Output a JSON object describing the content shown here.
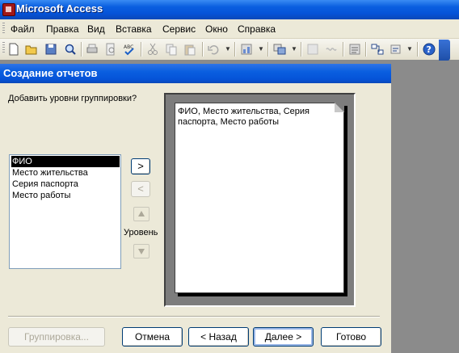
{
  "app": {
    "title": "Microsoft Access"
  },
  "menu": [
    {
      "label": "Файл"
    },
    {
      "label": "Правка"
    },
    {
      "label": "Вид"
    },
    {
      "label": "Вставка"
    },
    {
      "label": "Сервис"
    },
    {
      "label": "Окно"
    },
    {
      "label": "Справка"
    }
  ],
  "toolbar": {
    "icons": [
      "new-icon",
      "open-icon",
      "save-icon",
      "search-icon",
      "print-icon",
      "print-preview-icon",
      "spelling-icon",
      "cut-icon",
      "copy-icon",
      "paste-icon",
      "undo-icon",
      "analyze-icon",
      "office-links-icon",
      "code-icon",
      "properties-icon",
      "relationships-icon",
      "new-object-icon",
      "help-icon"
    ]
  },
  "dialog": {
    "title": "Создание отчетов",
    "prompt": "Добавить уровни группировки?",
    "fields": [
      "ФИО",
      "Место жительства",
      "Серия паспорта",
      "Место работы"
    ],
    "selected_index": 0,
    "move_right_label": ">",
    "move_left_label": "<",
    "level_label": "Уровень",
    "preview_text": "ФИО, Место жительства, Серия паспорта, Место работы",
    "buttons": {
      "grouping": "Группировка...",
      "cancel": "Отмена",
      "back": "< Назад",
      "next": "Далее >",
      "finish": "Готово"
    }
  }
}
